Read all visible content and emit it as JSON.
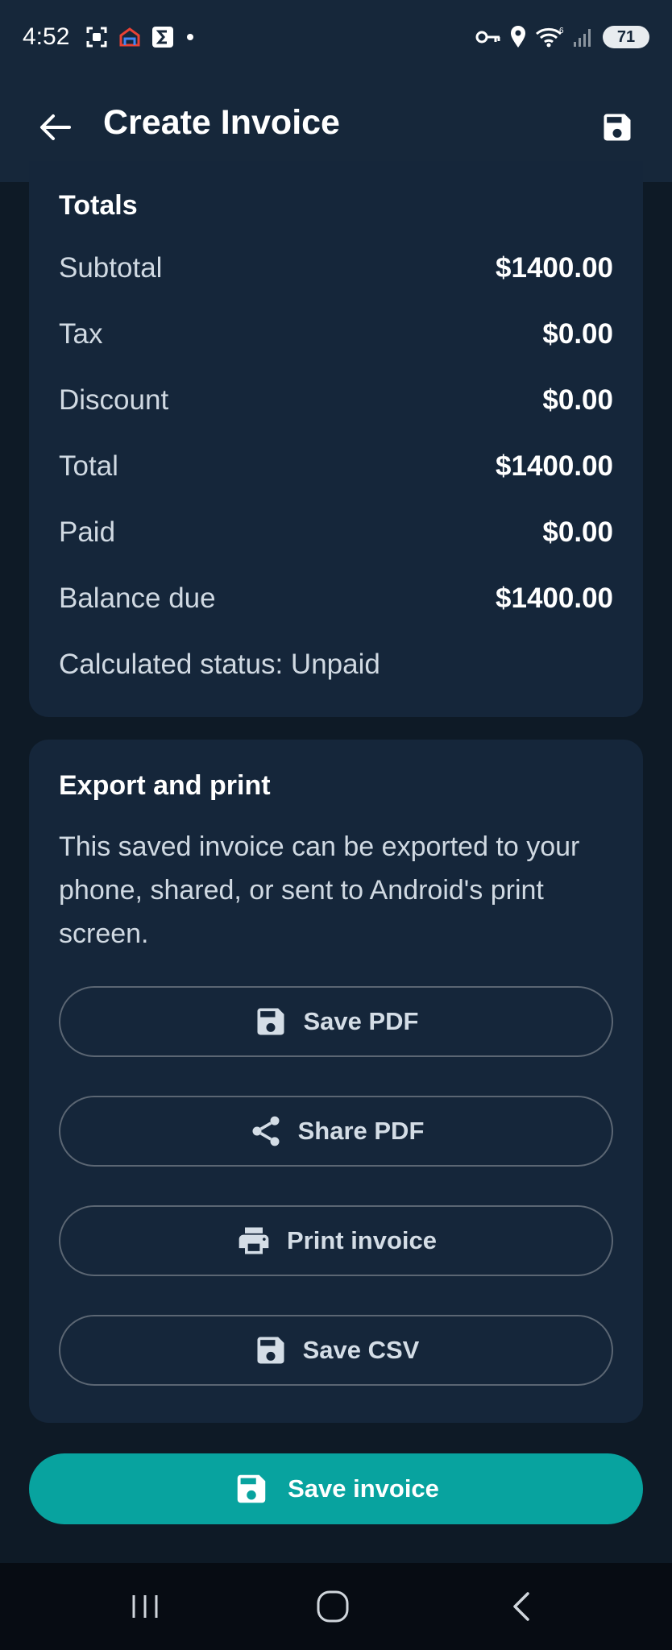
{
  "status_bar": {
    "time": "4:52",
    "battery": "71",
    "left_icons": [
      "screenshot-icon",
      "home-app-icon",
      "sigma-app-icon",
      "dot-icon"
    ],
    "right_icons": [
      "vpn-key-icon",
      "location-icon",
      "wifi-icon",
      "signal-icon",
      "battery-icon"
    ]
  },
  "app_bar": {
    "title": "Create Invoice",
    "back_icon": "arrow-left-icon",
    "save_icon": "save-icon"
  },
  "totals": {
    "title": "Totals",
    "rows": [
      {
        "label": "Subtotal",
        "value": "$1400.00"
      },
      {
        "label": "Tax",
        "value": "$0.00"
      },
      {
        "label": "Discount",
        "value": "$0.00"
      },
      {
        "label": "Total",
        "value": "$1400.00"
      },
      {
        "label": "Paid",
        "value": "$0.00"
      },
      {
        "label": "Balance due",
        "value": "$1400.00"
      }
    ],
    "status_text": "Calculated status: Unpaid"
  },
  "export": {
    "title": "Export and print",
    "description": "This saved invoice can be exported to your phone, shared, or sent to Android's print screen.",
    "buttons": [
      {
        "label": "Save PDF",
        "icon": "save-icon"
      },
      {
        "label": "Share PDF",
        "icon": "share-icon"
      },
      {
        "label": "Print invoice",
        "icon": "print-icon"
      },
      {
        "label": "Save CSV",
        "icon": "save-icon"
      }
    ]
  },
  "save_button": {
    "label": "Save invoice",
    "icon": "save-icon"
  },
  "colors": {
    "background": "#0e1a26",
    "card": "#15263a",
    "app_bar": "#16273a",
    "accent": "#08a39f",
    "outline": "#5b6673"
  }
}
